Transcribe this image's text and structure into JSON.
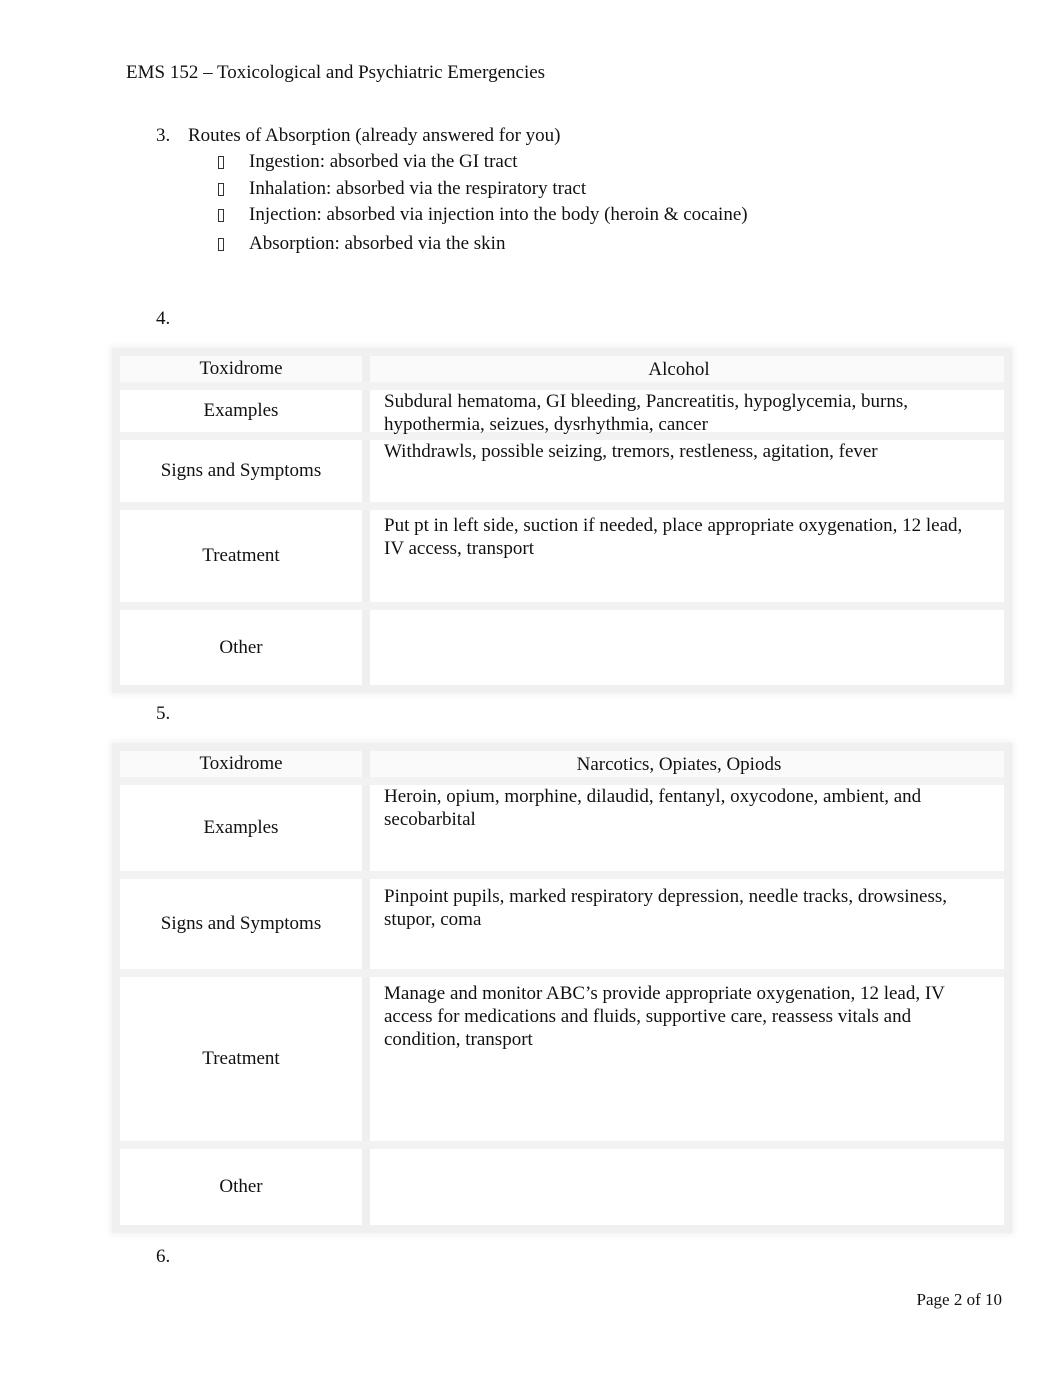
{
  "header": {
    "title": "EMS 152 – Toxicological and Psychiatric Emergencies"
  },
  "question3": {
    "number": "3.",
    "label": "Routes of Absorption (already answered for you)",
    "bullet_icon": "missing-glyph-box",
    "items": [
      "Ingestion: absorbed via the GI tract",
      "Inhalation: absorbed via the respiratory tract",
      "Injection: absorbed via injection into the body (heroin & cocaine)",
      "Absorption: absorbed via the skin"
    ]
  },
  "question4": {
    "number": "4.",
    "table": {
      "header": [
        "Toxidrome",
        "Alcohol"
      ],
      "rows": [
        {
          "label": "Examples",
          "value": "Subdural hematoma, GI bleeding, Pancreatitis, hypoglycemia, burns, hypothermia, seizues, dysrhythmia, cancer"
        },
        {
          "label": "Signs and Symptoms",
          "value": "Withdrawls, possible seizing, tremors, restleness, agitation, fever"
        },
        {
          "label": "Treatment",
          "value": "Put pt in left side, suction if needed, place appropriate oxygenation, 12 lead, IV access, transport"
        },
        {
          "label": "Other",
          "value": ""
        }
      ]
    }
  },
  "question5": {
    "number": "5.",
    "table": {
      "header": [
        "Toxidrome",
        "Narcotics, Opiates, Opiods"
      ],
      "rows": [
        {
          "label": "Examples",
          "value": "Heroin, opium, morphine, dilaudid, fentanyl, oxycodone, ambient, and secobarbital"
        },
        {
          "label": "Signs and Symptoms",
          "value": "Pinpoint pupils, marked respiratory depression, needle tracks, drowsiness, stupor, coma"
        },
        {
          "label": "Treatment",
          "value": "Manage and monitor ABC’s provide appropriate oxygenation, 12 lead, IV access for medications and fluids, supportive care, reassess vitals and condition, transport"
        },
        {
          "label": "Other",
          "value": ""
        }
      ]
    }
  },
  "question6": {
    "number": "6."
  },
  "footer": {
    "page_label": "Page 2 of 10"
  }
}
